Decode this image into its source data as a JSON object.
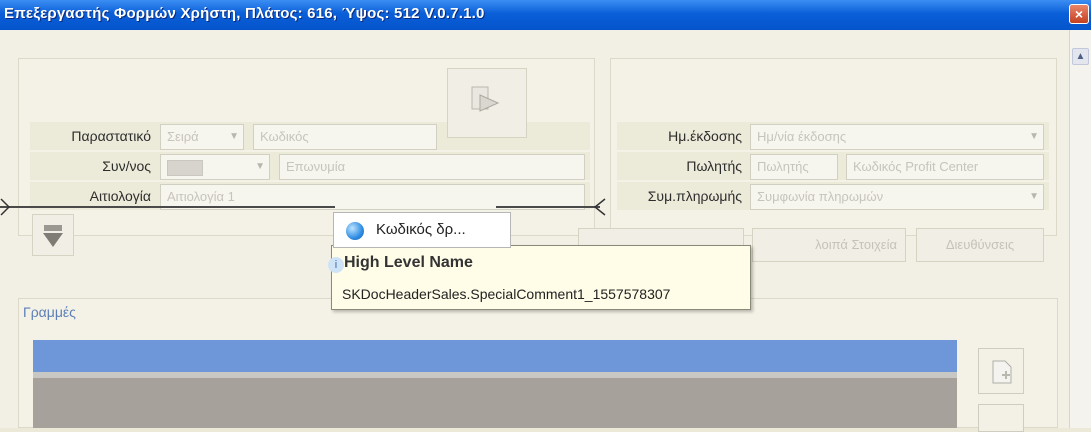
{
  "window": {
    "title": "Επεξεργαστής Φορμών Χρήστη, Πλάτος: 616, Ύψος: 512 V.0.7.1.0",
    "close_glyph": "×"
  },
  "left_form": {
    "rows": [
      {
        "label": "Παραστατικό",
        "fields": [
          "Σειρά",
          "Κωδικός"
        ]
      },
      {
        "label": "Συν/νος",
        "fields": [
          "",
          "Επωνυμία"
        ]
      },
      {
        "label": "Αιτιολογία",
        "fields": [
          "Αιτιολογία 1"
        ]
      }
    ]
  },
  "right_form": {
    "rows": [
      {
        "label": "Ημ.έκδοσης",
        "fields": [
          "Ημ/νία έκδοσης"
        ]
      },
      {
        "label": "Πωλητής",
        "fields": [
          "Πωλητής",
          "Κωδικός Profit Center"
        ]
      },
      {
        "label": "Συμ.πληρωμής",
        "fields": [
          "Συμφωνία πληρωμών"
        ]
      }
    ]
  },
  "buttons": {
    "other_data": "λοιπά Στοιχεία",
    "addresses": "Διευθύνσεις"
  },
  "popup": {
    "text": "Κωδικός δρ..."
  },
  "tooltip": {
    "title": "High Level Name",
    "text": "SKDocHeaderSales.SpecialComment1_1557578307"
  },
  "lines_section": {
    "label": "Γραμμές"
  },
  "icons": [
    "copy-icon",
    "down-arrow-icon",
    "document-icon",
    "info-icon",
    "globe-icon",
    "dropdown-arrow-icon",
    "scroll-up-icon"
  ]
}
